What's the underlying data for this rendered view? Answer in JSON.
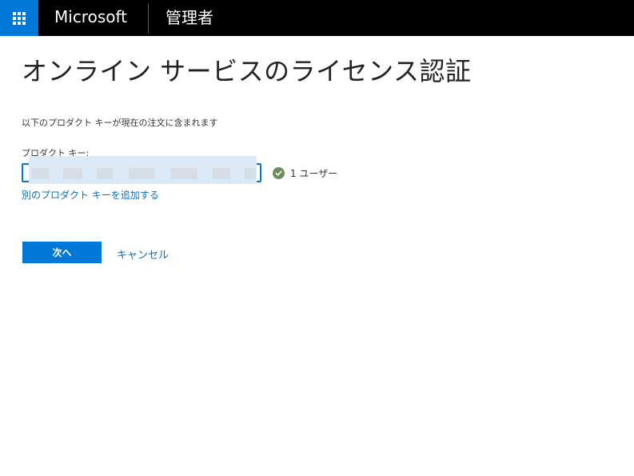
{
  "header": {
    "brand": "Microsoft",
    "app_name": "管理者",
    "accent_color": "#0078d7",
    "launcher_icon": "app-launcher-waffle-icon"
  },
  "main": {
    "title": "オンライン サービスのライセンス認証",
    "description": "以下のプロダクト キーが現在の注文に含まれます",
    "product_key_label": "プロダクト キー:",
    "product_key_value": "",
    "status_icon": "check-circle-icon",
    "status_color": "#6b8e5a",
    "status_text": "1 ユーザー",
    "add_key_link": "別のプロダクト キーを追加する",
    "next_button": "次へ",
    "cancel_link": "キャンセル"
  }
}
